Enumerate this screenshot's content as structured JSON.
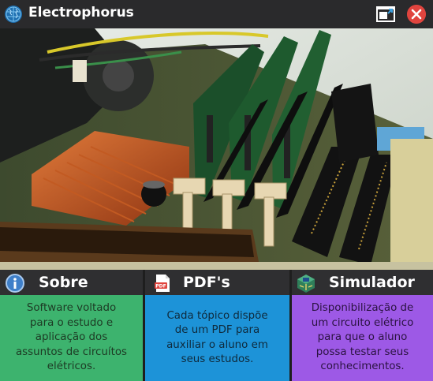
{
  "window": {
    "title": "Electrophorus",
    "icons": {
      "app": "globe-logo-icon",
      "restore": "restore-window-icon",
      "close": "close-icon"
    },
    "colors": {
      "titlebar": "#2a2a2c",
      "close": "#e0443e"
    }
  },
  "hero": {
    "description_icon": "motherboard-photo"
  },
  "cards": {
    "sobre": {
      "title": "Sobre",
      "icon": "info-icon",
      "text": "Software voltado para o estudo e aplicação dos assuntos de circuítos elétricos.",
      "color": "#3db36e"
    },
    "pdfs": {
      "title": "PDF's",
      "icon": "pdf-file-icon",
      "text": "Cada tópico dispõe de um PDF para auxiliar o aluno em seus estudos.",
      "color": "#1d93d8"
    },
    "simulador": {
      "title": "Simulador",
      "icon": "circuit-board-icon",
      "text": "Disponibilização de um circuito elétrico para que o aluno possa testar seus conhecimentos.",
      "color": "#9d59e6"
    }
  }
}
